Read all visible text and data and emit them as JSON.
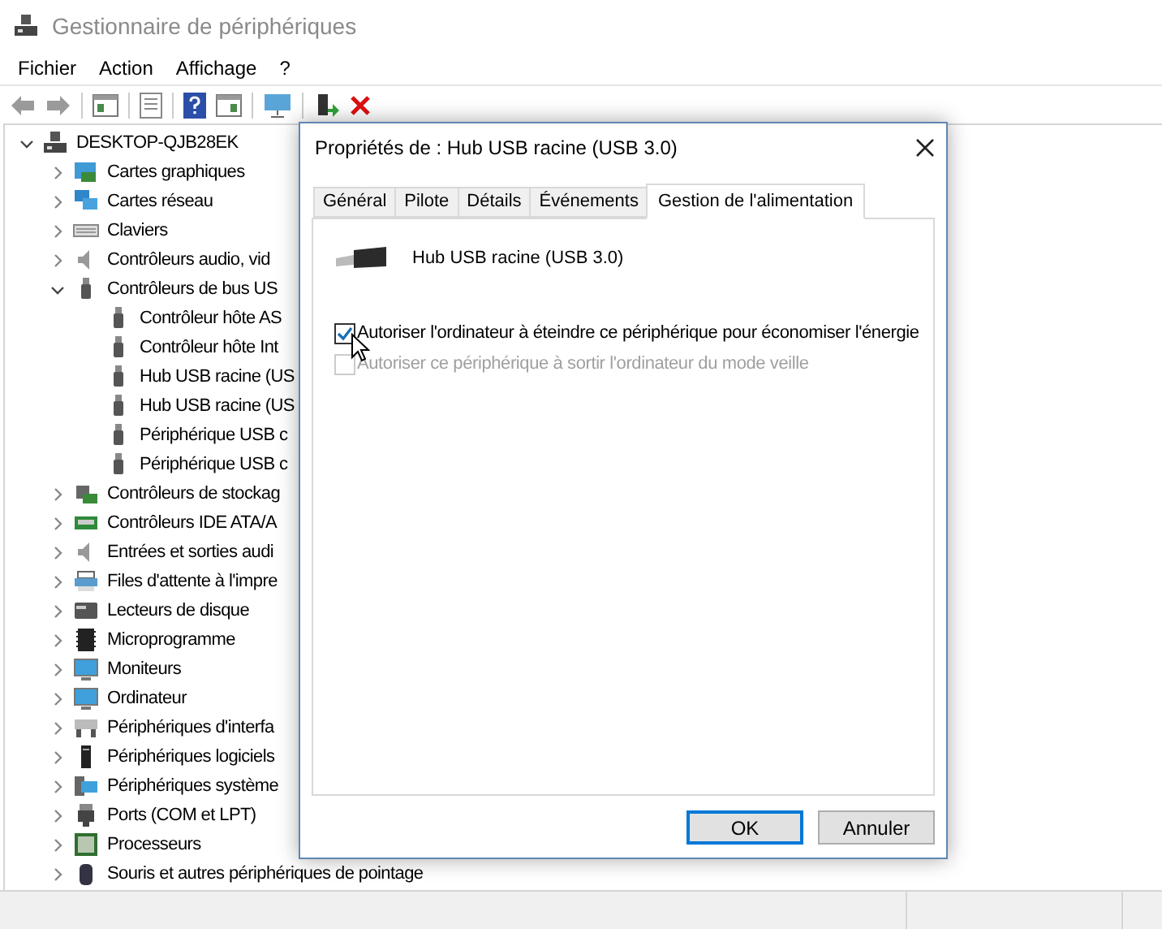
{
  "window": {
    "title": "Gestionnaire de périphériques"
  },
  "menu": [
    {
      "label": "Fichier"
    },
    {
      "label": "Action"
    },
    {
      "label": "Affichage"
    },
    {
      "label": "?"
    }
  ],
  "tree": {
    "label": "DESKTOP-QJB28EK",
    "expanded": true,
    "children": [
      {
        "label": "Cartes graphiques",
        "expanded": false
      },
      {
        "label": "Cartes réseau",
        "expanded": false
      },
      {
        "label": "Claviers",
        "expanded": false
      },
      {
        "label": "Contrôleurs audio, vid",
        "expanded": false
      },
      {
        "label": "Contrôleurs de bus US",
        "expanded": true,
        "children": [
          {
            "label": "Contrôleur hôte AS"
          },
          {
            "label": "Contrôleur hôte Int"
          },
          {
            "label": "Hub USB racine (US"
          },
          {
            "label": "Hub USB racine (US"
          },
          {
            "label": "Périphérique USB c"
          },
          {
            "label": "Périphérique USB c"
          }
        ]
      },
      {
        "label": "Contrôleurs de stockag",
        "expanded": false
      },
      {
        "label": "Contrôleurs IDE ATA/A",
        "expanded": false
      },
      {
        "label": "Entrées et sorties audi",
        "expanded": false
      },
      {
        "label": "Files d'attente à l'impre",
        "expanded": false
      },
      {
        "label": "Lecteurs de disque",
        "expanded": false
      },
      {
        "label": "Microprogramme",
        "expanded": false
      },
      {
        "label": "Moniteurs",
        "expanded": false
      },
      {
        "label": "Ordinateur",
        "expanded": false
      },
      {
        "label": "Périphériques d'interfa",
        "expanded": false
      },
      {
        "label": "Périphériques logiciels",
        "expanded": false
      },
      {
        "label": "Périphériques système",
        "expanded": false
      },
      {
        "label": "Ports (COM et LPT)",
        "expanded": false
      },
      {
        "label": "Processeurs",
        "expanded": false
      },
      {
        "label": "Souris et autres périphériques de pointage",
        "expanded": false
      }
    ]
  },
  "dialog": {
    "title": "Propriétés de : Hub USB racine (USB 3.0)",
    "tabs": [
      {
        "label": "Général",
        "selected": false
      },
      {
        "label": "Pilote",
        "selected": false
      },
      {
        "label": "Détails",
        "selected": false
      },
      {
        "label": "Événements",
        "selected": false
      },
      {
        "label": "Gestion de l'alimentation",
        "selected": true
      }
    ],
    "device_name": "Hub USB racine (USB 3.0)",
    "options": [
      {
        "label": "Autoriser l'ordinateur à éteindre ce périphérique pour économiser l'énergie",
        "checked": true,
        "disabled": false
      },
      {
        "label": "Autoriser ce périphérique à sortir l'ordinateur du mode veille",
        "checked": false,
        "disabled": true
      }
    ],
    "buttons": [
      {
        "label": "OK",
        "default": true
      },
      {
        "label": "Annuler",
        "default": false
      }
    ]
  }
}
